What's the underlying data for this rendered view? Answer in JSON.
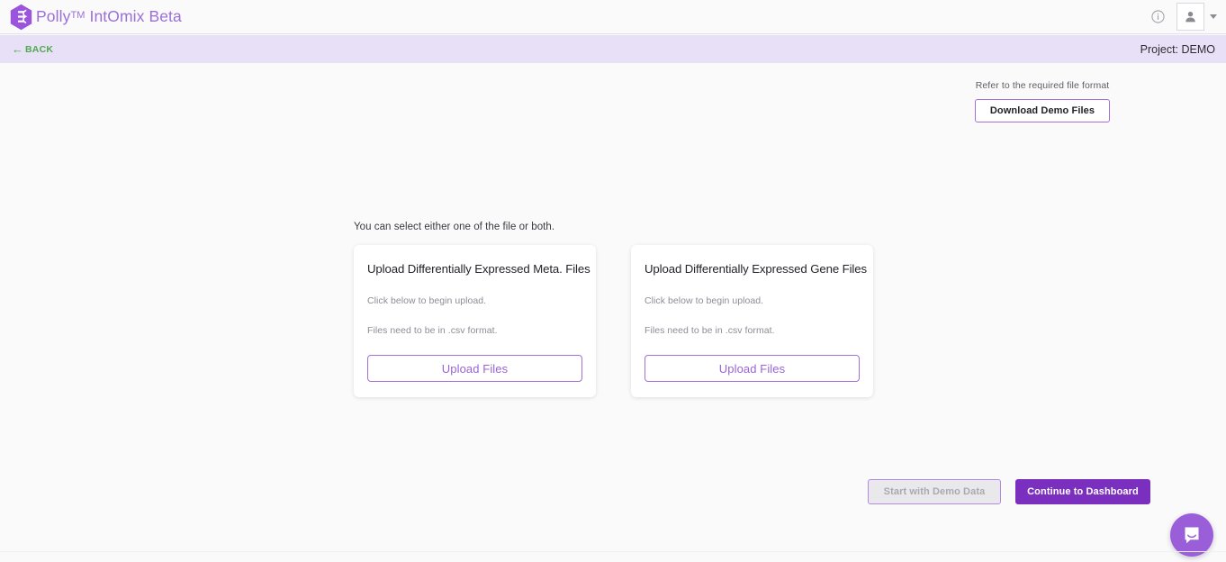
{
  "header": {
    "brand_name": "Polly",
    "brand_tm": "TM",
    "brand_suffix": "IntOmix Beta",
    "info_icon": "info-circle-icon",
    "user_icon": "user-avatar-icon",
    "caret_icon": "chevron-down-icon",
    "brand_color": "#9b6fd8"
  },
  "projectbar": {
    "back_arrow": "←",
    "back_label": "BACK",
    "project_label": "Project: DEMO",
    "background": "#e8e0f7",
    "back_color": "#4faa4f"
  },
  "demo_section": {
    "hint": "Refer to the required file format",
    "button_label": "Download Demo Files"
  },
  "main": {
    "select_note": "You can select either one of the file or both.",
    "cards": [
      {
        "title": "Upload Differentially Expressed Meta. Files",
        "line1": "Click below to begin upload.",
        "line2": "Files need to be in .csv format.",
        "button_label": "Upload Files"
      },
      {
        "title": "Upload Differentially Expressed Gene Files",
        "line1": "Click below to begin upload.",
        "line2": "Files need to be in .csv format.",
        "button_label": "Upload Files"
      }
    ]
  },
  "footer_actions": {
    "demo_data_label": "Start with Demo Data",
    "demo_data_disabled": true,
    "continue_label": "Continue to Dashboard",
    "continue_color": "#7b2fbe"
  },
  "chat": {
    "icon": "chat-bubble-icon",
    "color": "#9a5fd8"
  }
}
